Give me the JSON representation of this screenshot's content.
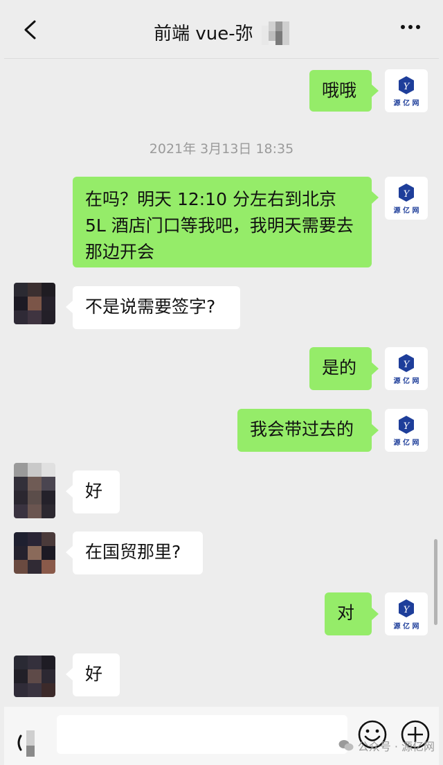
{
  "header": {
    "title": "前端 vue-弥",
    "back_icon": "chevron-left-icon",
    "more_icon": "more-horizontal-icon"
  },
  "logo_avatar": {
    "brand_text": "源 亿 网",
    "color": "#1e3e9a"
  },
  "messages": [
    {
      "side": "right",
      "text": "哦哦"
    },
    {
      "side": "right",
      "text": "在吗？明天 12:10 分左右到北京 5L 酒店门口等我吧，我明天需要去那边开会"
    },
    {
      "side": "left",
      "text": "不是说需要签字?"
    },
    {
      "side": "right",
      "text": "是的"
    },
    {
      "side": "right",
      "text": "我会带过去的"
    },
    {
      "side": "left",
      "text": "好"
    },
    {
      "side": "left",
      "text": "在国贸那里?"
    },
    {
      "side": "right",
      "text": "对"
    },
    {
      "side": "left",
      "text": "好"
    }
  ],
  "timestamp": "2021年 3月13日 18:35",
  "input": {
    "placeholder": "",
    "value": ""
  },
  "input_icons": [
    "voice-icon",
    "emoji-icon",
    "plus-icon"
  ],
  "watermark": "公众号 · 源亿网",
  "colors": {
    "me_bubble": "#95ec69",
    "other_bubble": "#ffffff",
    "background": "#ededed"
  }
}
